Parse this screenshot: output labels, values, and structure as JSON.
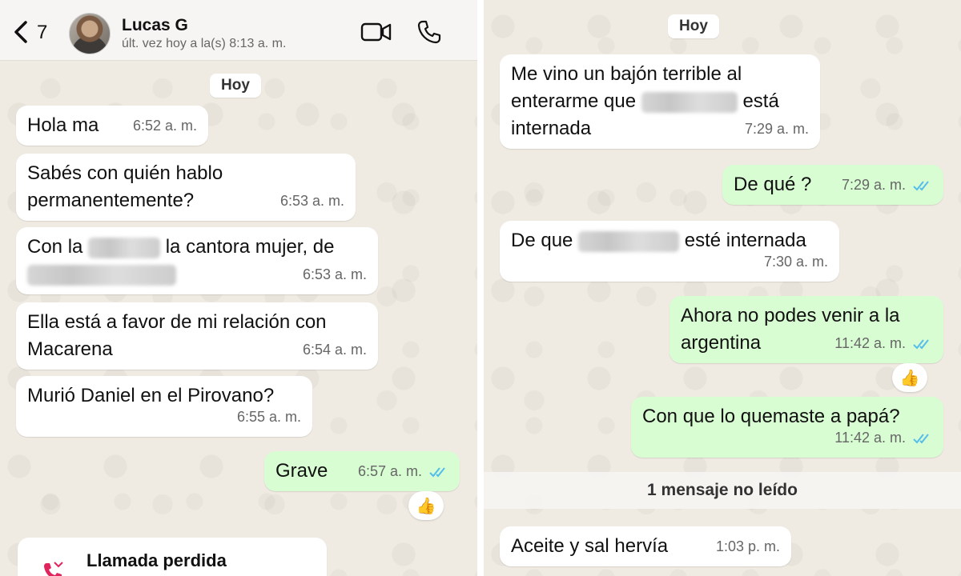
{
  "colors": {
    "chat_background": "#efeae2",
    "incoming_bubble": "#ffffff",
    "outgoing_bubble": "#d9fdd3",
    "read_ticks": "#53bdeb",
    "missed_call_red": "#e0245e"
  },
  "left": {
    "header": {
      "back_count": "7",
      "contact_name": "Lucas G",
      "last_seen": "últ. vez hoy a la(s) 8:13 a. m.",
      "icons": [
        "back-chevron-icon",
        "video-call-icon",
        "voice-call-icon"
      ]
    },
    "day_label": "Hoy",
    "messages": [
      {
        "dir": "in",
        "text": "Hola ma",
        "time": "6:52 a. m."
      },
      {
        "dir": "in",
        "text": "Sabés con quién hablo permanentemente?",
        "time": "6:53 a. m."
      },
      {
        "dir": "in",
        "text_before": "Con la",
        "text_after": "la cantora mujer, de",
        "time": "6:53 a. m."
      },
      {
        "dir": "in",
        "text": "Ella está a favor de mi relación con Macarena",
        "time": "6:54 a. m."
      },
      {
        "dir": "in",
        "text": "Murió Daniel en el Pirovano?",
        "time": "6:55 a. m."
      },
      {
        "dir": "out",
        "text": "Grave",
        "time": "6:57 a. m.",
        "reaction": "👍"
      }
    ],
    "missed_call": {
      "label": "Llamada perdida",
      "icon": "missed-call-icon"
    }
  },
  "right": {
    "day_label": "Hoy",
    "messages": [
      {
        "dir": "in",
        "text_line1": "Me vino un bajón terrible al",
        "text_before": "enterarme que",
        "text_after": "está",
        "text_line3": "internada",
        "time": "7:29 a. m."
      },
      {
        "dir": "out",
        "text": "De qué ?",
        "time": "7:29 a. m."
      },
      {
        "dir": "in",
        "text_before": "De que",
        "text_after": "esté internada",
        "time": "7:30 a. m."
      },
      {
        "dir": "out",
        "text": "Ahora no podes venir a la argentina",
        "time": "11:42 a. m.",
        "reaction": "👍"
      },
      {
        "dir": "out",
        "text": "Con que lo quemaste a papá?",
        "time": "11:42 a. m."
      }
    ],
    "unread_label": "1 mensaje no leído",
    "last_message": {
      "dir": "in",
      "text": "Aceite y sal hervía",
      "time": "1:03 p. m."
    }
  }
}
